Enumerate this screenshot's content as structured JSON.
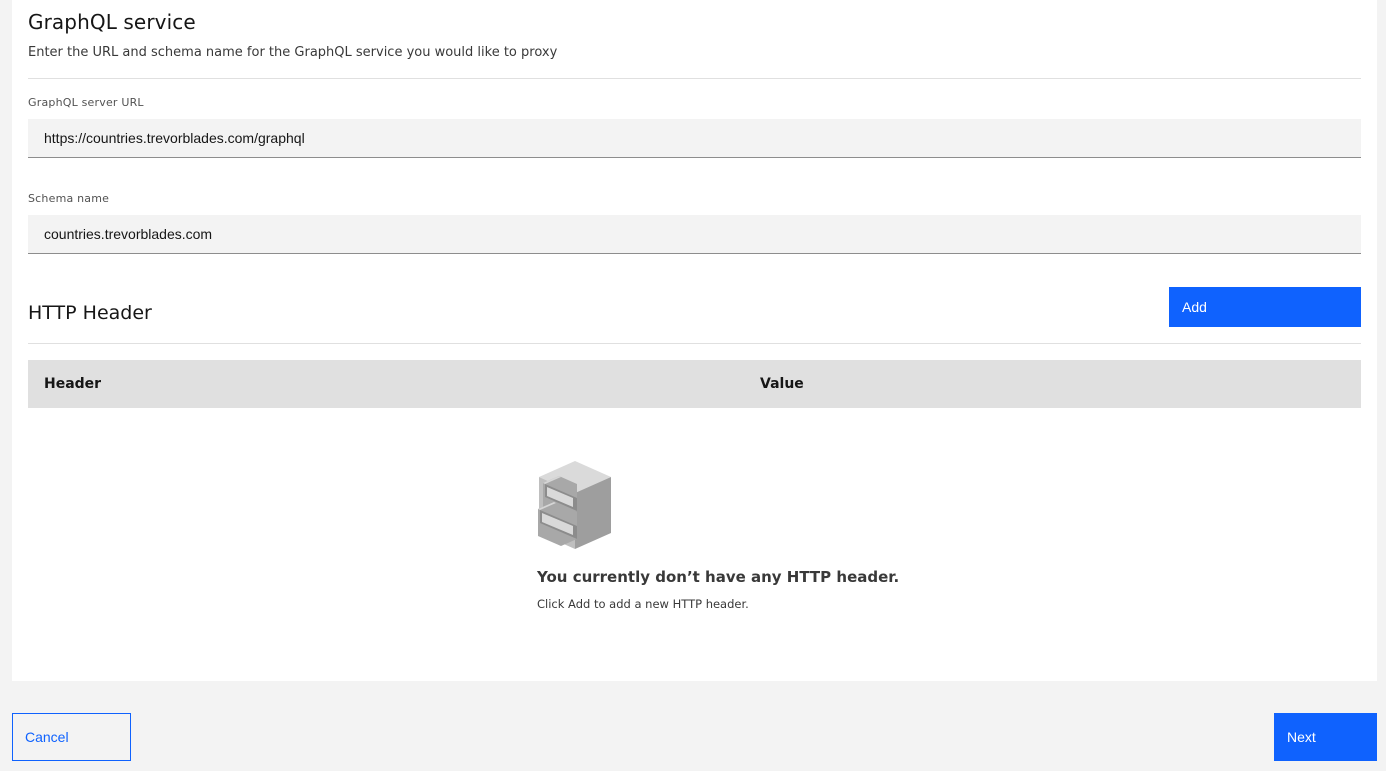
{
  "service": {
    "title": "GraphQL service",
    "description": "Enter the URL and schema name for the GraphQL service you would like to proxy"
  },
  "fields": {
    "server_url": {
      "label": "GraphQL server URL",
      "value": "https://countries.trevorblades.com/graphql"
    },
    "schema_name": {
      "label": "Schema name",
      "value": "countries.trevorblades.com"
    }
  },
  "http_header": {
    "title": "HTTP Header",
    "add_label": "Add",
    "columns": [
      "Header",
      "Value"
    ],
    "empty_title": "You currently don’t have any HTTP header.",
    "empty_subtitle": "Click Add to add a new HTTP header.",
    "empty_icon": "filing-cabinet-icon"
  },
  "footer": {
    "cancel_label": "Cancel",
    "next_label": "Next"
  },
  "colors": {
    "primary": "#0f62fe",
    "field_bg": "#f3f3f3",
    "table_header_bg": "#e0e0e0"
  }
}
